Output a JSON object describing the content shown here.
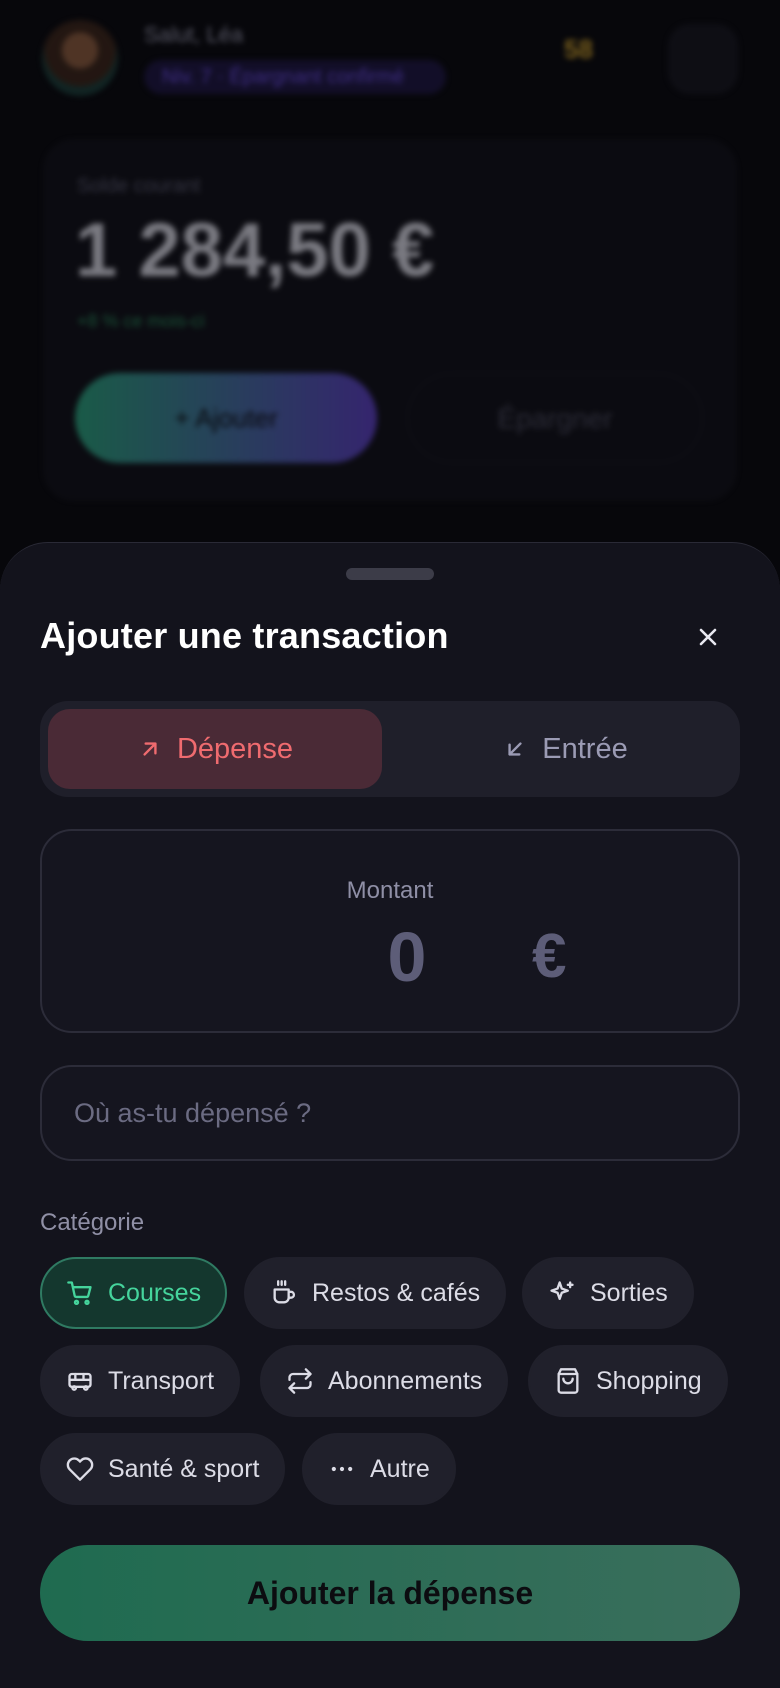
{
  "background": {
    "greeting": "Salut, Léa",
    "level": "Niv. 7 · Épargnant confirmé",
    "coins": "58",
    "balance_label": "Solde courant",
    "balance": "1 284,50 €",
    "trend": "+8 % ce mois-ci",
    "add_label": "+ Ajouter",
    "save_label": "Épargner"
  },
  "sheet": {
    "title": "Ajouter une transaction",
    "tabs": {
      "expense": "Dépense",
      "income": "Entrée",
      "selected": "expense"
    },
    "amount": {
      "label": "Montant",
      "value": "0",
      "currency": "€"
    },
    "place": {
      "placeholder": "Où as-tu dépensé ?",
      "value": ""
    },
    "category_label": "Catégorie",
    "categories": [
      {
        "label": "Courses",
        "icon": "cart-icon",
        "active": true
      },
      {
        "label": "Restos & cafés",
        "icon": "coffee-icon",
        "active": false
      },
      {
        "label": "Sorties",
        "icon": "sparkles-icon",
        "active": false
      },
      {
        "label": "Transport",
        "icon": "bus-icon",
        "active": false
      },
      {
        "label": "Abonnements",
        "icon": "repeat-icon",
        "active": false
      },
      {
        "label": "Shopping",
        "icon": "shopping-bag-icon",
        "active": false
      },
      {
        "label": "Santé & sport",
        "icon": "heart-icon",
        "active": false
      },
      {
        "label": "Autre",
        "icon": "more-horizontal-icon",
        "active": false
      }
    ],
    "submit_label": "Ajouter la dépense"
  },
  "colors": {
    "sheet_bg": "#13131c",
    "expense_accent": "#ef6b6f",
    "active_category": "#45d49c",
    "submit_bg": "#1f6b50"
  }
}
